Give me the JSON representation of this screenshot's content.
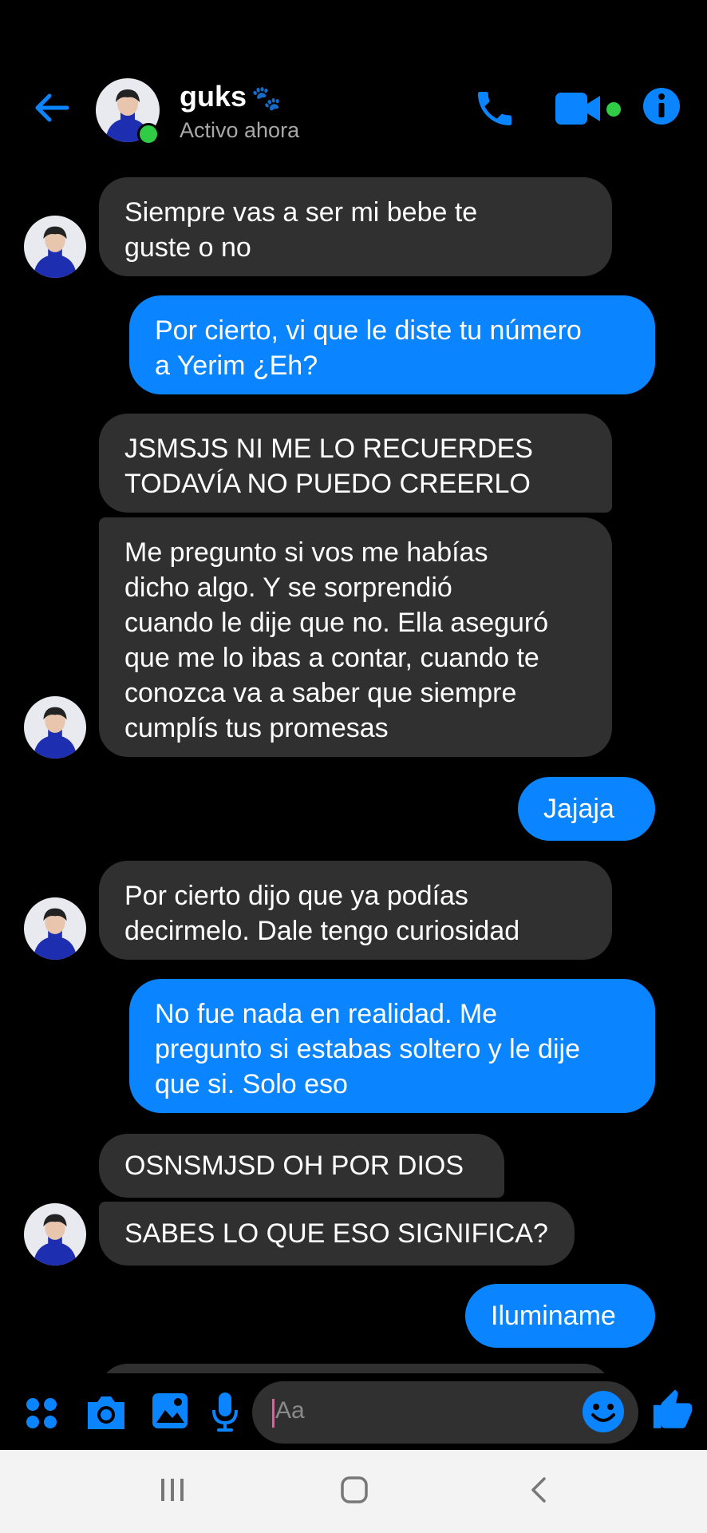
{
  "header": {
    "contact_name": "guks",
    "contact_emoji": "🐾",
    "status": "Activo ahora"
  },
  "messages": [
    {
      "side": "in",
      "text": "Siempre vas a ser mi bebe te\nguste o no"
    },
    {
      "side": "out",
      "text": "Por cierto, vi que le diste tu número\na Yerim ¿Eh?"
    },
    {
      "side": "in",
      "text": "JSMSJS NI ME LO RECUERDES\nTODAVÍA NO PUEDO CREERLO"
    },
    {
      "side": "in",
      "text": "Me pregunto si vos me habías\ndicho algo. Y se sorprendió\ncuando le dije que no. Ella aseguró\nque me lo ibas a contar, cuando te\nconozca va a saber que siempre\ncumplís tus promesas"
    },
    {
      "side": "out",
      "text": "Jajaja"
    },
    {
      "side": "in",
      "text": "Por cierto dijo que ya podías\ndecirmelo. Dale tengo curiosidad"
    },
    {
      "side": "out",
      "text": "No fue nada en realidad. Me\npregunto si estabas soltero y le dije\nque si. Solo eso"
    },
    {
      "side": "in",
      "text": "OSNSMJSD OH POR DIOS"
    },
    {
      "side": "in",
      "text": "SABES LO QUE ESO SIGNIFICA?"
    },
    {
      "side": "out",
      "text": "Iluminame"
    }
  ],
  "composer": {
    "placeholder": "Aa"
  },
  "colors": {
    "accent": "#0a84ff",
    "incoming_bubble": "#303030",
    "online": "#31cc46"
  }
}
